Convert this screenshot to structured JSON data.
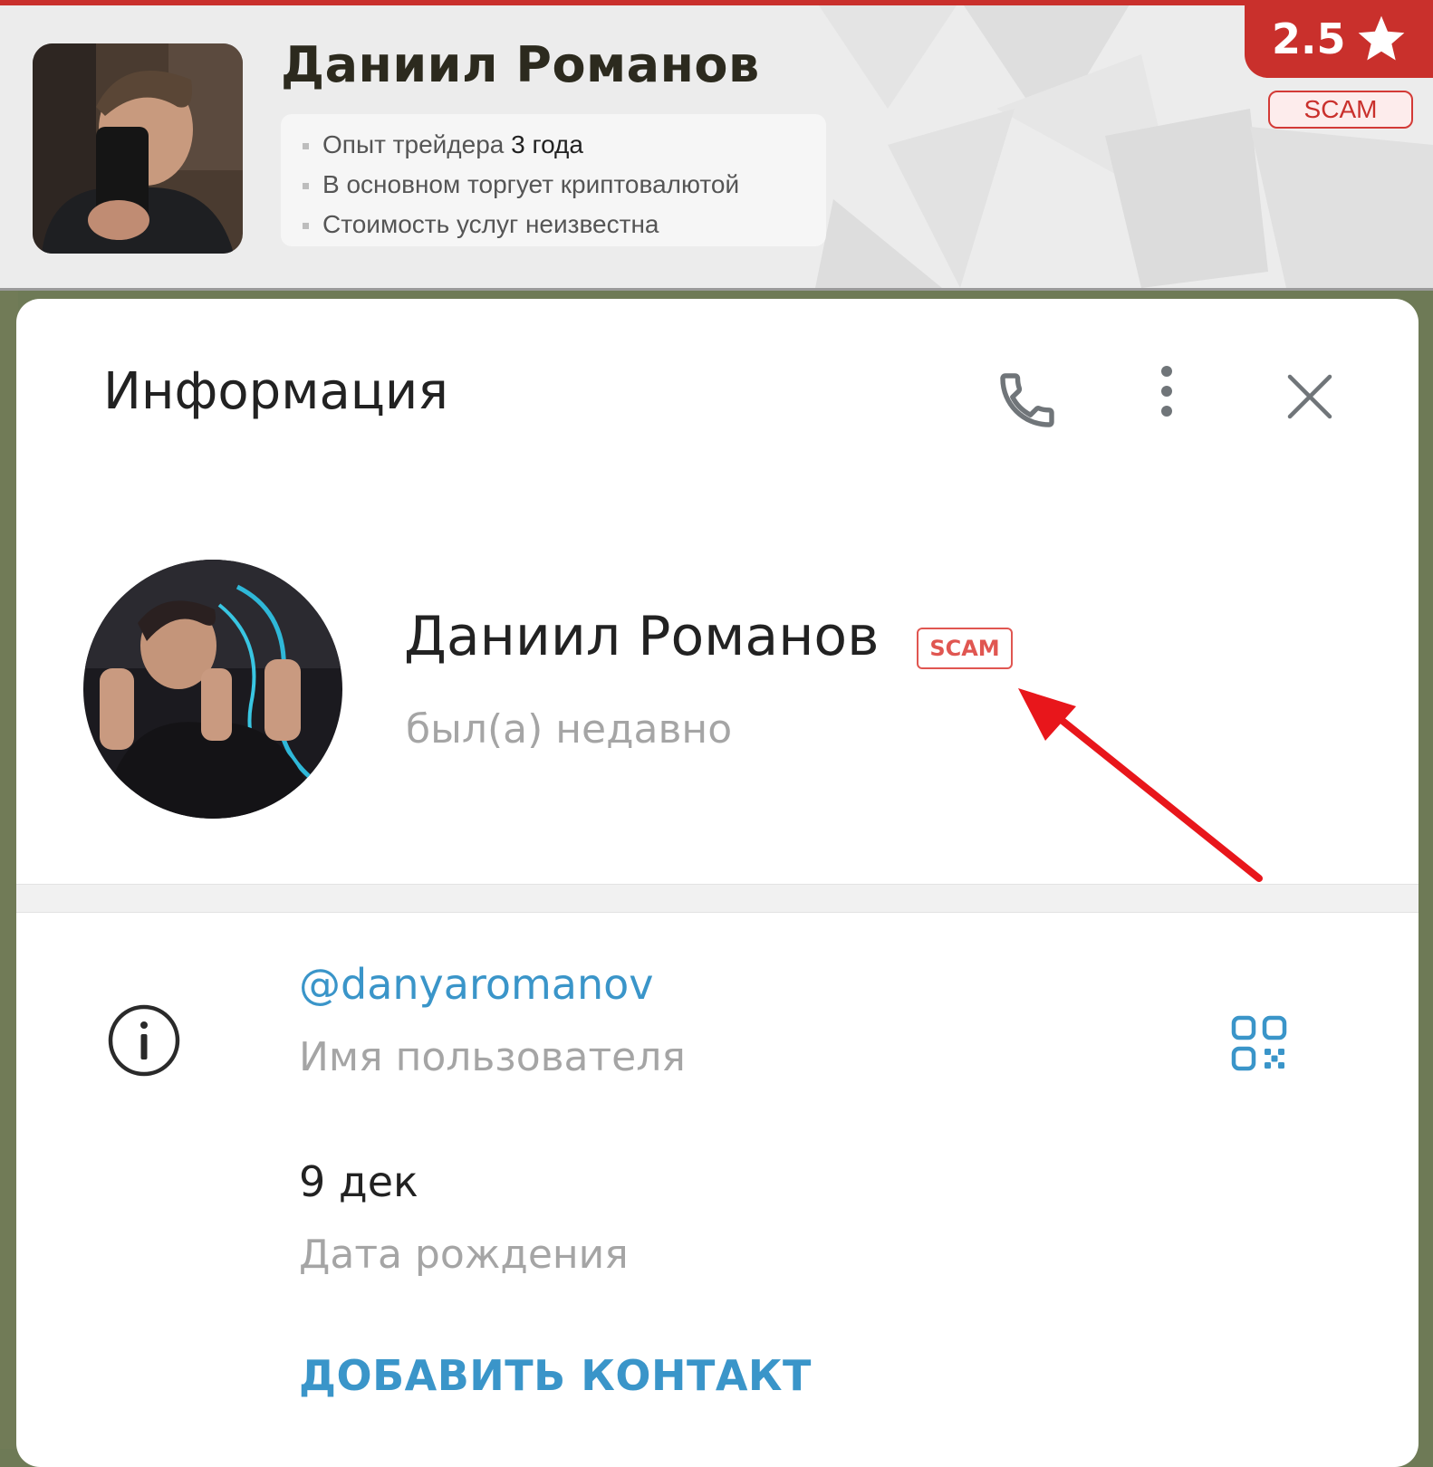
{
  "review_card": {
    "trader_name": "Даниил Романов",
    "facts": [
      {
        "text": "Опыт трейдера ",
        "highlight": "3 года"
      },
      {
        "text": "В основном торгует криптовалютой",
        "highlight": ""
      },
      {
        "text": "Стоимость услуг неизвестна",
        "highlight": ""
      }
    ],
    "rating": "2.5",
    "scam_badge": "SCAM",
    "accent_color": "#c9302c"
  },
  "info_dialog": {
    "title": "Информация",
    "profile": {
      "name": "Даниил Романов",
      "scam_label": "SCAM",
      "status": "был(а) недавно"
    },
    "username": {
      "value": "@danyaromanov",
      "caption": "Имя пользователя"
    },
    "birthday": {
      "value": "9 дек",
      "caption": "Дата рождения"
    },
    "add_contact_label": "ДОБАВИТЬ КОНТАКТ",
    "link_color": "#3a95c9",
    "icons": [
      "phone-icon",
      "more-vertical-icon",
      "close-icon",
      "info-icon",
      "qr-code-icon"
    ]
  }
}
